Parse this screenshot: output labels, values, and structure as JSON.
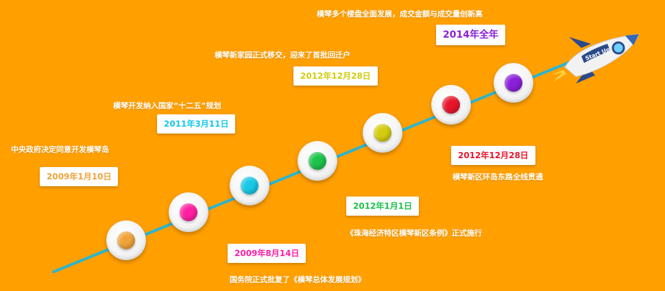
{
  "timeline": {
    "line_color": "#2ab5d0",
    "events": [
      {
        "date": "2009年1月10日",
        "desc": "中央政府决定同意开发横琴岛",
        "color": "#f0a33b"
      },
      {
        "date": "2009年8月14日",
        "desc": "国务院正式批复了《横琴总体发展规划》",
        "color": "#ff1fa3"
      },
      {
        "date": "2011年3月11日",
        "desc": "横琴开发纳入国家“十二五”规划",
        "color": "#18c8e6"
      },
      {
        "date": "2012年1月1日",
        "desc": "《珠海经济特区横琴新区条例》正式施行",
        "color": "#1ec34a"
      },
      {
        "date": "2012年12月28日",
        "desc": "横琴新家园正式移交，迎来了首批回迁户",
        "color": "#d4cc10"
      },
      {
        "date": "2012年12月28日",
        "desc": "横琴新区环岛东路全线贯通",
        "color": "#e8162b"
      },
      {
        "date": "2014年全年",
        "desc": "横琴多个楼盘全面发展，成交金额与成交量创新高",
        "color": "#8a1fd9"
      }
    ]
  },
  "rocket": {
    "label": "Start Up",
    "icon": "rocket-icon"
  }
}
